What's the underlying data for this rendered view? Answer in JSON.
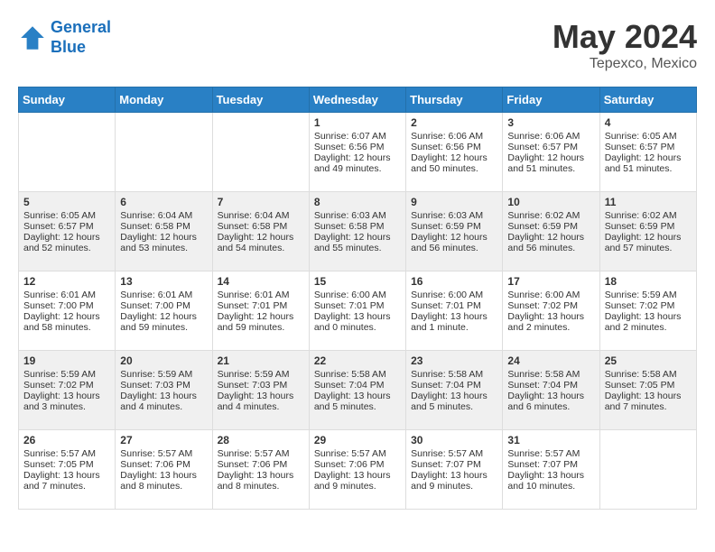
{
  "header": {
    "logo_line1": "General",
    "logo_line2": "Blue",
    "month": "May 2024",
    "location": "Tepexco, Mexico"
  },
  "days_of_week": [
    "Sunday",
    "Monday",
    "Tuesday",
    "Wednesday",
    "Thursday",
    "Friday",
    "Saturday"
  ],
  "weeks": [
    [
      {
        "day": "",
        "content": ""
      },
      {
        "day": "",
        "content": ""
      },
      {
        "day": "",
        "content": ""
      },
      {
        "day": "1",
        "content": "Sunrise: 6:07 AM\nSunset: 6:56 PM\nDaylight: 12 hours\nand 49 minutes."
      },
      {
        "day": "2",
        "content": "Sunrise: 6:06 AM\nSunset: 6:56 PM\nDaylight: 12 hours\nand 50 minutes."
      },
      {
        "day": "3",
        "content": "Sunrise: 6:06 AM\nSunset: 6:57 PM\nDaylight: 12 hours\nand 51 minutes."
      },
      {
        "day": "4",
        "content": "Sunrise: 6:05 AM\nSunset: 6:57 PM\nDaylight: 12 hours\nand 51 minutes."
      }
    ],
    [
      {
        "day": "5",
        "content": "Sunrise: 6:05 AM\nSunset: 6:57 PM\nDaylight: 12 hours\nand 52 minutes."
      },
      {
        "day": "6",
        "content": "Sunrise: 6:04 AM\nSunset: 6:58 PM\nDaylight: 12 hours\nand 53 minutes."
      },
      {
        "day": "7",
        "content": "Sunrise: 6:04 AM\nSunset: 6:58 PM\nDaylight: 12 hours\nand 54 minutes."
      },
      {
        "day": "8",
        "content": "Sunrise: 6:03 AM\nSunset: 6:58 PM\nDaylight: 12 hours\nand 55 minutes."
      },
      {
        "day": "9",
        "content": "Sunrise: 6:03 AM\nSunset: 6:59 PM\nDaylight: 12 hours\nand 56 minutes."
      },
      {
        "day": "10",
        "content": "Sunrise: 6:02 AM\nSunset: 6:59 PM\nDaylight: 12 hours\nand 56 minutes."
      },
      {
        "day": "11",
        "content": "Sunrise: 6:02 AM\nSunset: 6:59 PM\nDaylight: 12 hours\nand 57 minutes."
      }
    ],
    [
      {
        "day": "12",
        "content": "Sunrise: 6:01 AM\nSunset: 7:00 PM\nDaylight: 12 hours\nand 58 minutes."
      },
      {
        "day": "13",
        "content": "Sunrise: 6:01 AM\nSunset: 7:00 PM\nDaylight: 12 hours\nand 59 minutes."
      },
      {
        "day": "14",
        "content": "Sunrise: 6:01 AM\nSunset: 7:01 PM\nDaylight: 12 hours\nand 59 minutes."
      },
      {
        "day": "15",
        "content": "Sunrise: 6:00 AM\nSunset: 7:01 PM\nDaylight: 13 hours\nand 0 minutes."
      },
      {
        "day": "16",
        "content": "Sunrise: 6:00 AM\nSunset: 7:01 PM\nDaylight: 13 hours\nand 1 minute."
      },
      {
        "day": "17",
        "content": "Sunrise: 6:00 AM\nSunset: 7:02 PM\nDaylight: 13 hours\nand 2 minutes."
      },
      {
        "day": "18",
        "content": "Sunrise: 5:59 AM\nSunset: 7:02 PM\nDaylight: 13 hours\nand 2 minutes."
      }
    ],
    [
      {
        "day": "19",
        "content": "Sunrise: 5:59 AM\nSunset: 7:02 PM\nDaylight: 13 hours\nand 3 minutes."
      },
      {
        "day": "20",
        "content": "Sunrise: 5:59 AM\nSunset: 7:03 PM\nDaylight: 13 hours\nand 4 minutes."
      },
      {
        "day": "21",
        "content": "Sunrise: 5:59 AM\nSunset: 7:03 PM\nDaylight: 13 hours\nand 4 minutes."
      },
      {
        "day": "22",
        "content": "Sunrise: 5:58 AM\nSunset: 7:04 PM\nDaylight: 13 hours\nand 5 minutes."
      },
      {
        "day": "23",
        "content": "Sunrise: 5:58 AM\nSunset: 7:04 PM\nDaylight: 13 hours\nand 5 minutes."
      },
      {
        "day": "24",
        "content": "Sunrise: 5:58 AM\nSunset: 7:04 PM\nDaylight: 13 hours\nand 6 minutes."
      },
      {
        "day": "25",
        "content": "Sunrise: 5:58 AM\nSunset: 7:05 PM\nDaylight: 13 hours\nand 7 minutes."
      }
    ],
    [
      {
        "day": "26",
        "content": "Sunrise: 5:57 AM\nSunset: 7:05 PM\nDaylight: 13 hours\nand 7 minutes."
      },
      {
        "day": "27",
        "content": "Sunrise: 5:57 AM\nSunset: 7:06 PM\nDaylight: 13 hours\nand 8 minutes."
      },
      {
        "day": "28",
        "content": "Sunrise: 5:57 AM\nSunset: 7:06 PM\nDaylight: 13 hours\nand 8 minutes."
      },
      {
        "day": "29",
        "content": "Sunrise: 5:57 AM\nSunset: 7:06 PM\nDaylight: 13 hours\nand 9 minutes."
      },
      {
        "day": "30",
        "content": "Sunrise: 5:57 AM\nSunset: 7:07 PM\nDaylight: 13 hours\nand 9 minutes."
      },
      {
        "day": "31",
        "content": "Sunrise: 5:57 AM\nSunset: 7:07 PM\nDaylight: 13 hours\nand 10 minutes."
      },
      {
        "day": "",
        "content": ""
      }
    ]
  ]
}
